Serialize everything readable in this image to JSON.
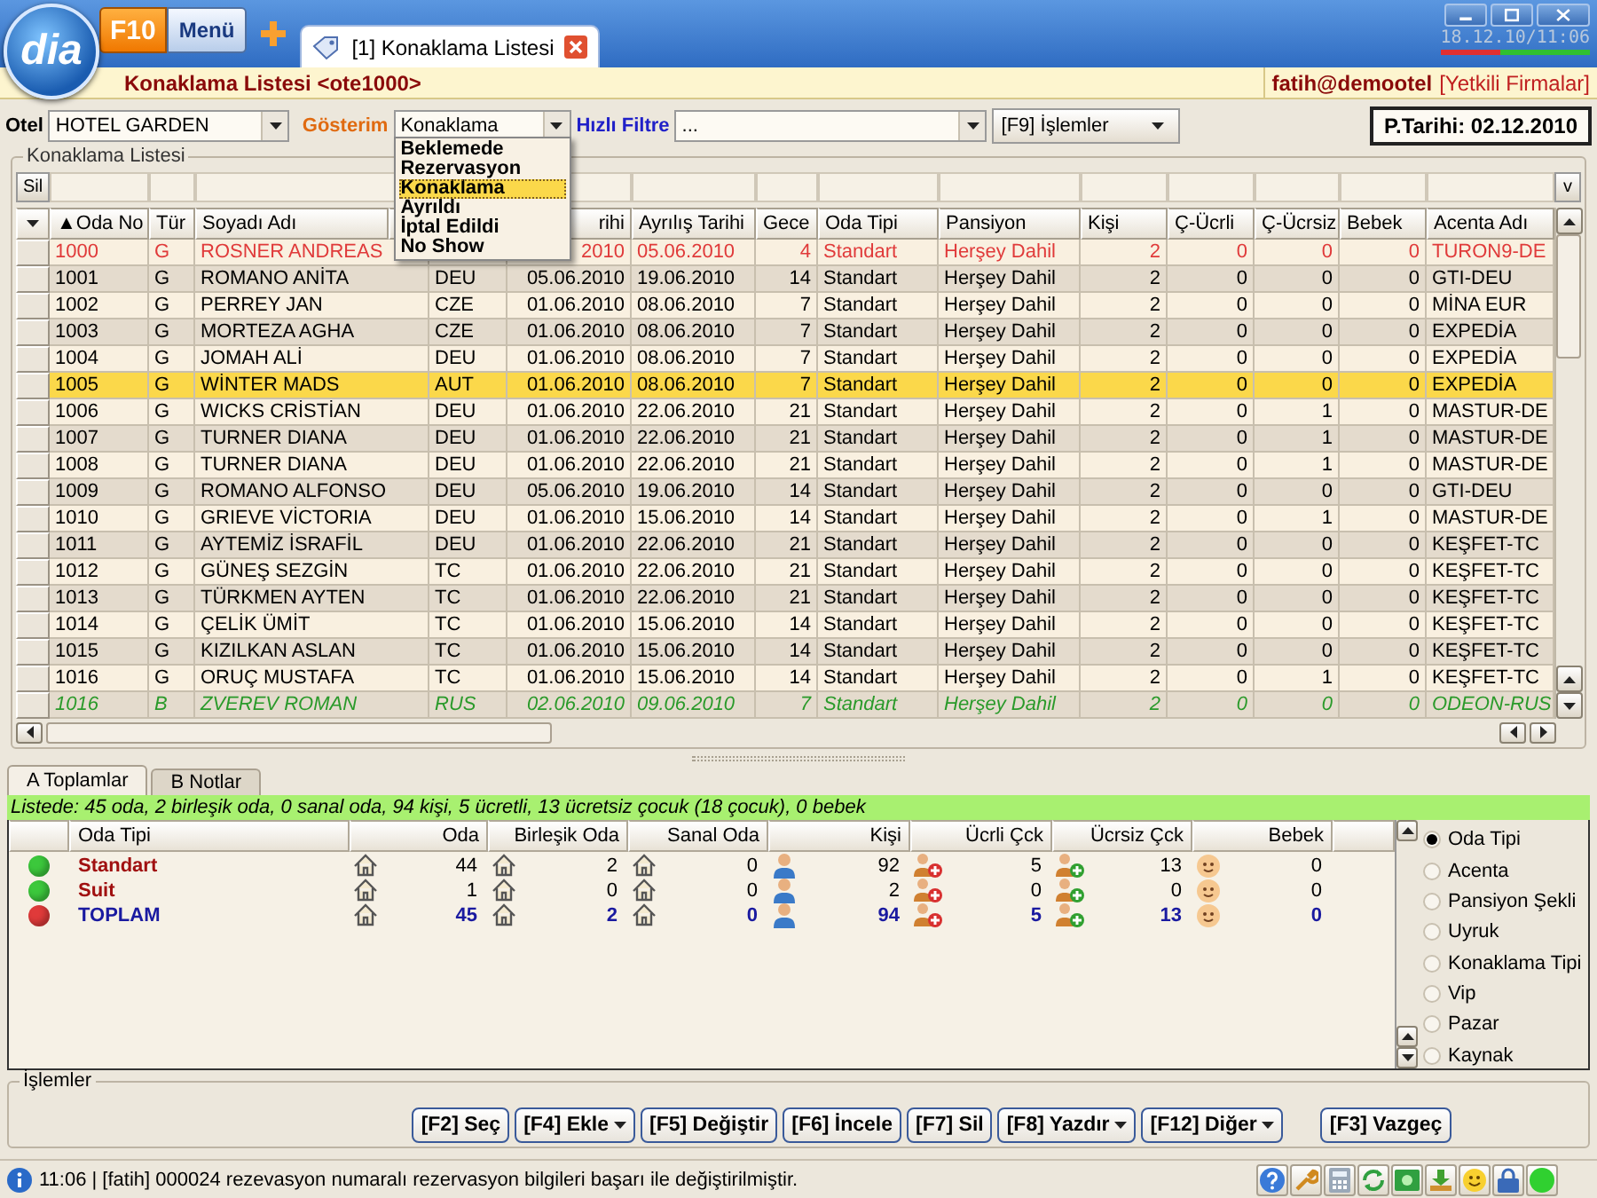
{
  "app": {
    "logo": "dia",
    "menu_key": "F10",
    "menu_label": "Menü"
  },
  "tabs": [
    {
      "label": "[1] Konaklama Listesi",
      "selected": true
    }
  ],
  "clock": "18.12.10/11:06",
  "header": {
    "title": "Konaklama Listesi <ote1000>",
    "user": "fatih@demootel",
    "firms": "[Yetkili Firmalar]"
  },
  "filters": {
    "hotel_label": "Otel",
    "hotel": "HOTEL GARDEN",
    "view_label": "Gösterim",
    "view": "Konaklama",
    "quick_label": "Hızlı Filtre",
    "quick": "...",
    "actions": "[F9] İşlemler",
    "date": "P.Tarihi: 02.12.2010"
  },
  "view_menu": [
    {
      "label": "Beklemede",
      "selected": false
    },
    {
      "label": "Rezervasyon",
      "selected": false
    },
    {
      "label": "Konaklama",
      "selected": true
    },
    {
      "label": "Ayrıldı",
      "selected": false
    },
    {
      "label": "İptal Edildi",
      "selected": false
    },
    {
      "label": "No Show",
      "selected": false
    }
  ],
  "list": {
    "title": "Konaklama Listesi",
    "clear": "Sil",
    "more": "v",
    "columns": [
      "▲Oda No",
      "Tür",
      "Soyadı Adı",
      null,
      "rihi",
      "Ayrılış Tarihi",
      "Gece",
      "Oda Tipi",
      "Pansiyon",
      "Kişi",
      "Ç-Ücrli",
      "Ç-Ücrsiz",
      "Bebek",
      "Acenta Adı"
    ],
    "rows": [
      {
        "kind": "alert",
        "selected": false,
        "cells": [
          "1000",
          "G",
          "ROSNER ANDREAS",
          null,
          "2010",
          "05.06.2010",
          "4",
          "Standart",
          "Herşey Dahil",
          "2",
          "0",
          "0",
          "0",
          "TURON9-DE"
        ]
      },
      {
        "kind": "regular",
        "selected": false,
        "cells": [
          "1001",
          "G",
          "ROMANO ANİTA",
          "DEU",
          "05.06.2010",
          "19.06.2010",
          "14",
          "Standart",
          "Herşey Dahil",
          "2",
          "0",
          "0",
          "0",
          "GTI-DEU"
        ]
      },
      {
        "kind": "regular",
        "selected": false,
        "cells": [
          "1002",
          "G",
          "PERREY JAN",
          "CZE",
          "01.06.2010",
          "08.06.2010",
          "7",
          "Standart",
          "Herşey Dahil",
          "2",
          "0",
          "0",
          "0",
          "MİNA EUR"
        ]
      },
      {
        "kind": "regular",
        "selected": false,
        "cells": [
          "1003",
          "G",
          "MORTEZA AGHA",
          "CZE",
          "01.06.2010",
          "08.06.2010",
          "7",
          "Standart",
          "Herşey Dahil",
          "2",
          "0",
          "0",
          "0",
          "EXPEDİA"
        ]
      },
      {
        "kind": "regular",
        "selected": false,
        "cells": [
          "1004",
          "G",
          "JOMAH ALİ",
          "DEU",
          "01.06.2010",
          "08.06.2010",
          "7",
          "Standart",
          "Herşey Dahil",
          "2",
          "0",
          "0",
          "0",
          "EXPEDİA"
        ]
      },
      {
        "kind": "regular",
        "selected": true,
        "cells": [
          "1005",
          "G",
          "WİNTER MADS",
          "AUT",
          "01.06.2010",
          "08.06.2010",
          "7",
          "Standart",
          "Herşey Dahil",
          "2",
          "0",
          "0",
          "0",
          "EXPEDİA"
        ]
      },
      {
        "kind": "regular",
        "selected": false,
        "cells": [
          "1006",
          "G",
          "WICKS CRİSTİAN",
          "DEU",
          "01.06.2010",
          "22.06.2010",
          "21",
          "Standart",
          "Herşey Dahil",
          "2",
          "0",
          "1",
          "0",
          "MASTUR-DE"
        ]
      },
      {
        "kind": "regular",
        "selected": false,
        "cells": [
          "1007",
          "G",
          "TURNER DIANA",
          "DEU",
          "01.06.2010",
          "22.06.2010",
          "21",
          "Standart",
          "Herşey Dahil",
          "2",
          "0",
          "1",
          "0",
          "MASTUR-DE"
        ]
      },
      {
        "kind": "regular",
        "selected": false,
        "cells": [
          "1008",
          "G",
          "TURNER DIANA",
          "DEU",
          "01.06.2010",
          "22.06.2010",
          "21",
          "Standart",
          "Herşey Dahil",
          "2",
          "0",
          "1",
          "0",
          "MASTUR-DE"
        ]
      },
      {
        "kind": "regular",
        "selected": false,
        "cells": [
          "1009",
          "G",
          "ROMANO ALFONSO",
          "DEU",
          "05.06.2010",
          "19.06.2010",
          "14",
          "Standart",
          "Herşey Dahil",
          "2",
          "0",
          "0",
          "0",
          "GTI-DEU"
        ]
      },
      {
        "kind": "regular",
        "selected": false,
        "cells": [
          "1010",
          "G",
          "GRIEVE VİCTORIA",
          "DEU",
          "01.06.2010",
          "15.06.2010",
          "14",
          "Standart",
          "Herşey Dahil",
          "2",
          "0",
          "1",
          "0",
          "MASTUR-DE"
        ]
      },
      {
        "kind": "regular",
        "selected": false,
        "cells": [
          "1011",
          "G",
          "AYTEMİZ İSRAFİL",
          "DEU",
          "01.06.2010",
          "22.06.2010",
          "21",
          "Standart",
          "Herşey Dahil",
          "2",
          "0",
          "0",
          "0",
          "KEŞFET-TC"
        ]
      },
      {
        "kind": "regular",
        "selected": false,
        "cells": [
          "1012",
          "G",
          "GÜNEŞ SEZGİN",
          "TC",
          "01.06.2010",
          "22.06.2010",
          "21",
          "Standart",
          "Herşey Dahil",
          "2",
          "0",
          "0",
          "0",
          "KEŞFET-TC"
        ]
      },
      {
        "kind": "regular",
        "selected": false,
        "cells": [
          "1013",
          "G",
          "TÜRKMEN AYTEN",
          "TC",
          "01.06.2010",
          "22.06.2010",
          "21",
          "Standart",
          "Herşey Dahil",
          "2",
          "0",
          "0",
          "0",
          "KEŞFET-TC"
        ]
      },
      {
        "kind": "regular",
        "selected": false,
        "cells": [
          "1014",
          "G",
          "ÇELİK ÜMİT",
          "TC",
          "01.06.2010",
          "15.06.2010",
          "14",
          "Standart",
          "Herşey Dahil",
          "2",
          "0",
          "0",
          "0",
          "KEŞFET-TC"
        ]
      },
      {
        "kind": "regular",
        "selected": false,
        "cells": [
          "1015",
          "G",
          "KIZILKAN ASLAN",
          "TC",
          "01.06.2010",
          "15.06.2010",
          "14",
          "Standart",
          "Herşey Dahil",
          "2",
          "0",
          "0",
          "0",
          "KEŞFET-TC"
        ]
      },
      {
        "kind": "regular",
        "selected": false,
        "cells": [
          "1016",
          "G",
          "ORUÇ MUSTAFA",
          "TC",
          "01.06.2010",
          "15.06.2010",
          "14",
          "Standart",
          "Herşey Dahil",
          "2",
          "0",
          "1",
          "0",
          "KEŞFET-TC"
        ]
      },
      {
        "kind": "option",
        "selected": false,
        "cells": [
          "1016",
          "B",
          "ZVEREV ROMAN",
          "RUS",
          "02.06.2010",
          "09.06.2010",
          "7",
          "Standart",
          "Herşey Dahil",
          "2",
          "0",
          "0",
          "0",
          "ODEON-RUS"
        ]
      }
    ]
  },
  "bottom_tabs": [
    {
      "label": "A Toplamlar",
      "selected": true
    },
    {
      "label": "B Notlar",
      "selected": false
    }
  ],
  "summary_text": "Listede: 45 oda, 2 birleşik oda, 0 sanal oda, 94 kişi, 5 ücretli, 13 ücretsiz çocuk (18 çocuk), 0 bebek",
  "totals": {
    "columns": [
      null,
      "Oda Tipi",
      "Oda",
      "Birleşik Oda",
      "Sanal Oda",
      "Kişi",
      "Ücrli Çck",
      "Ücrsiz Çck",
      "Bebek"
    ],
    "rows": [
      {
        "kind": "item",
        "color": "#3cc83c",
        "label": "Standart",
        "values": [
          "44",
          "2",
          "0",
          "92",
          "5",
          "13",
          "0"
        ]
      },
      {
        "kind": "item",
        "color": "#3cc83c",
        "label": "Suit",
        "values": [
          "1",
          "0",
          "0",
          "2",
          "0",
          "0",
          "0"
        ]
      },
      {
        "kind": "total",
        "color": "#e03a3a",
        "label": "TOPLAM",
        "values": [
          "45",
          "2",
          "0",
          "94",
          "5",
          "13",
          "0"
        ]
      }
    ]
  },
  "group_by": [
    {
      "label": "Oda Tipi",
      "selected": true
    },
    {
      "label": "Acenta",
      "selected": false
    },
    {
      "label": "Pansiyon Şekli",
      "selected": false
    },
    {
      "label": "Uyruk",
      "selected": false
    },
    {
      "label": "Konaklama Tipi",
      "selected": false
    },
    {
      "label": "Vip",
      "selected": false
    },
    {
      "label": "Pazar",
      "selected": false
    },
    {
      "label": "Kaynak",
      "selected": false
    }
  ],
  "actions": {
    "title": "İşlemler",
    "buttons": [
      {
        "label": "[F2] Seç",
        "menu": false
      },
      {
        "label": "[F4] Ekle",
        "menu": true
      },
      {
        "label": "[F5] Değiştir",
        "menu": false
      },
      {
        "label": "[F6] İncele",
        "menu": false
      },
      {
        "label": "[F7] Sil",
        "menu": false
      },
      {
        "label": "[F8] Yazdır",
        "menu": true
      },
      {
        "label": "[F12] Diğer",
        "menu": true
      }
    ],
    "cancel": "[F3] Vazgeç"
  },
  "status": {
    "message": "11:06 | [fatih] 000024 rezevasyon numaralı rezervasyon bilgileri başarı ile değiştirilmiştir."
  }
}
